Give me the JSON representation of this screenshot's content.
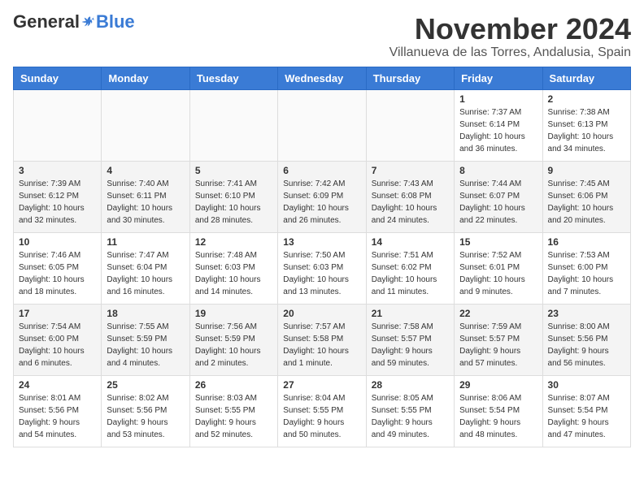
{
  "header": {
    "logo_general": "General",
    "logo_blue": "Blue",
    "month_title": "November 2024",
    "location": "Villanueva de las Torres, Andalusia, Spain"
  },
  "weekdays": [
    "Sunday",
    "Monday",
    "Tuesday",
    "Wednesday",
    "Thursday",
    "Friday",
    "Saturday"
  ],
  "weeks": [
    [
      {
        "day": "",
        "info": ""
      },
      {
        "day": "",
        "info": ""
      },
      {
        "day": "",
        "info": ""
      },
      {
        "day": "",
        "info": ""
      },
      {
        "day": "",
        "info": ""
      },
      {
        "day": "1",
        "info": "Sunrise: 7:37 AM\nSunset: 6:14 PM\nDaylight: 10 hours\nand 36 minutes."
      },
      {
        "day": "2",
        "info": "Sunrise: 7:38 AM\nSunset: 6:13 PM\nDaylight: 10 hours\nand 34 minutes."
      }
    ],
    [
      {
        "day": "3",
        "info": "Sunrise: 7:39 AM\nSunset: 6:12 PM\nDaylight: 10 hours\nand 32 minutes."
      },
      {
        "day": "4",
        "info": "Sunrise: 7:40 AM\nSunset: 6:11 PM\nDaylight: 10 hours\nand 30 minutes."
      },
      {
        "day": "5",
        "info": "Sunrise: 7:41 AM\nSunset: 6:10 PM\nDaylight: 10 hours\nand 28 minutes."
      },
      {
        "day": "6",
        "info": "Sunrise: 7:42 AM\nSunset: 6:09 PM\nDaylight: 10 hours\nand 26 minutes."
      },
      {
        "day": "7",
        "info": "Sunrise: 7:43 AM\nSunset: 6:08 PM\nDaylight: 10 hours\nand 24 minutes."
      },
      {
        "day": "8",
        "info": "Sunrise: 7:44 AM\nSunset: 6:07 PM\nDaylight: 10 hours\nand 22 minutes."
      },
      {
        "day": "9",
        "info": "Sunrise: 7:45 AM\nSunset: 6:06 PM\nDaylight: 10 hours\nand 20 minutes."
      }
    ],
    [
      {
        "day": "10",
        "info": "Sunrise: 7:46 AM\nSunset: 6:05 PM\nDaylight: 10 hours\nand 18 minutes."
      },
      {
        "day": "11",
        "info": "Sunrise: 7:47 AM\nSunset: 6:04 PM\nDaylight: 10 hours\nand 16 minutes."
      },
      {
        "day": "12",
        "info": "Sunrise: 7:48 AM\nSunset: 6:03 PM\nDaylight: 10 hours\nand 14 minutes."
      },
      {
        "day": "13",
        "info": "Sunrise: 7:50 AM\nSunset: 6:03 PM\nDaylight: 10 hours\nand 13 minutes."
      },
      {
        "day": "14",
        "info": "Sunrise: 7:51 AM\nSunset: 6:02 PM\nDaylight: 10 hours\nand 11 minutes."
      },
      {
        "day": "15",
        "info": "Sunrise: 7:52 AM\nSunset: 6:01 PM\nDaylight: 10 hours\nand 9 minutes."
      },
      {
        "day": "16",
        "info": "Sunrise: 7:53 AM\nSunset: 6:00 PM\nDaylight: 10 hours\nand 7 minutes."
      }
    ],
    [
      {
        "day": "17",
        "info": "Sunrise: 7:54 AM\nSunset: 6:00 PM\nDaylight: 10 hours\nand 6 minutes."
      },
      {
        "day": "18",
        "info": "Sunrise: 7:55 AM\nSunset: 5:59 PM\nDaylight: 10 hours\nand 4 minutes."
      },
      {
        "day": "19",
        "info": "Sunrise: 7:56 AM\nSunset: 5:59 PM\nDaylight: 10 hours\nand 2 minutes."
      },
      {
        "day": "20",
        "info": "Sunrise: 7:57 AM\nSunset: 5:58 PM\nDaylight: 10 hours\nand 1 minute."
      },
      {
        "day": "21",
        "info": "Sunrise: 7:58 AM\nSunset: 5:57 PM\nDaylight: 9 hours\nand 59 minutes."
      },
      {
        "day": "22",
        "info": "Sunrise: 7:59 AM\nSunset: 5:57 PM\nDaylight: 9 hours\nand 57 minutes."
      },
      {
        "day": "23",
        "info": "Sunrise: 8:00 AM\nSunset: 5:56 PM\nDaylight: 9 hours\nand 56 minutes."
      }
    ],
    [
      {
        "day": "24",
        "info": "Sunrise: 8:01 AM\nSunset: 5:56 PM\nDaylight: 9 hours\nand 54 minutes."
      },
      {
        "day": "25",
        "info": "Sunrise: 8:02 AM\nSunset: 5:56 PM\nDaylight: 9 hours\nand 53 minutes."
      },
      {
        "day": "26",
        "info": "Sunrise: 8:03 AM\nSunset: 5:55 PM\nDaylight: 9 hours\nand 52 minutes."
      },
      {
        "day": "27",
        "info": "Sunrise: 8:04 AM\nSunset: 5:55 PM\nDaylight: 9 hours\nand 50 minutes."
      },
      {
        "day": "28",
        "info": "Sunrise: 8:05 AM\nSunset: 5:55 PM\nDaylight: 9 hours\nand 49 minutes."
      },
      {
        "day": "29",
        "info": "Sunrise: 8:06 AM\nSunset: 5:54 PM\nDaylight: 9 hours\nand 48 minutes."
      },
      {
        "day": "30",
        "info": "Sunrise: 8:07 AM\nSunset: 5:54 PM\nDaylight: 9 hours\nand 47 minutes."
      }
    ]
  ]
}
